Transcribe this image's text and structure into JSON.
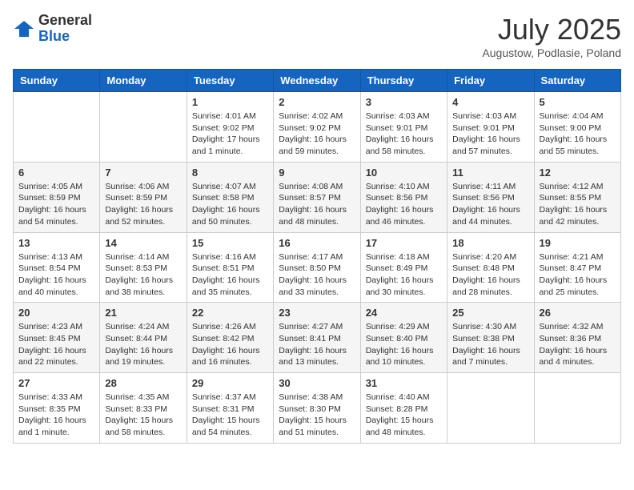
{
  "header": {
    "logo_general": "General",
    "logo_blue": "Blue",
    "month": "July 2025",
    "location": "Augustow, Podlasie, Poland"
  },
  "weekdays": [
    "Sunday",
    "Monday",
    "Tuesday",
    "Wednesday",
    "Thursday",
    "Friday",
    "Saturday"
  ],
  "weeks": [
    [
      {
        "day": "",
        "info": ""
      },
      {
        "day": "",
        "info": ""
      },
      {
        "day": "1",
        "info": "Sunrise: 4:01 AM\nSunset: 9:02 PM\nDaylight: 17 hours\nand 1 minute."
      },
      {
        "day": "2",
        "info": "Sunrise: 4:02 AM\nSunset: 9:02 PM\nDaylight: 16 hours\nand 59 minutes."
      },
      {
        "day": "3",
        "info": "Sunrise: 4:03 AM\nSunset: 9:01 PM\nDaylight: 16 hours\nand 58 minutes."
      },
      {
        "day": "4",
        "info": "Sunrise: 4:03 AM\nSunset: 9:01 PM\nDaylight: 16 hours\nand 57 minutes."
      },
      {
        "day": "5",
        "info": "Sunrise: 4:04 AM\nSunset: 9:00 PM\nDaylight: 16 hours\nand 55 minutes."
      }
    ],
    [
      {
        "day": "6",
        "info": "Sunrise: 4:05 AM\nSunset: 8:59 PM\nDaylight: 16 hours\nand 54 minutes."
      },
      {
        "day": "7",
        "info": "Sunrise: 4:06 AM\nSunset: 8:59 PM\nDaylight: 16 hours\nand 52 minutes."
      },
      {
        "day": "8",
        "info": "Sunrise: 4:07 AM\nSunset: 8:58 PM\nDaylight: 16 hours\nand 50 minutes."
      },
      {
        "day": "9",
        "info": "Sunrise: 4:08 AM\nSunset: 8:57 PM\nDaylight: 16 hours\nand 48 minutes."
      },
      {
        "day": "10",
        "info": "Sunrise: 4:10 AM\nSunset: 8:56 PM\nDaylight: 16 hours\nand 46 minutes."
      },
      {
        "day": "11",
        "info": "Sunrise: 4:11 AM\nSunset: 8:56 PM\nDaylight: 16 hours\nand 44 minutes."
      },
      {
        "day": "12",
        "info": "Sunrise: 4:12 AM\nSunset: 8:55 PM\nDaylight: 16 hours\nand 42 minutes."
      }
    ],
    [
      {
        "day": "13",
        "info": "Sunrise: 4:13 AM\nSunset: 8:54 PM\nDaylight: 16 hours\nand 40 minutes."
      },
      {
        "day": "14",
        "info": "Sunrise: 4:14 AM\nSunset: 8:53 PM\nDaylight: 16 hours\nand 38 minutes."
      },
      {
        "day": "15",
        "info": "Sunrise: 4:16 AM\nSunset: 8:51 PM\nDaylight: 16 hours\nand 35 minutes."
      },
      {
        "day": "16",
        "info": "Sunrise: 4:17 AM\nSunset: 8:50 PM\nDaylight: 16 hours\nand 33 minutes."
      },
      {
        "day": "17",
        "info": "Sunrise: 4:18 AM\nSunset: 8:49 PM\nDaylight: 16 hours\nand 30 minutes."
      },
      {
        "day": "18",
        "info": "Sunrise: 4:20 AM\nSunset: 8:48 PM\nDaylight: 16 hours\nand 28 minutes."
      },
      {
        "day": "19",
        "info": "Sunrise: 4:21 AM\nSunset: 8:47 PM\nDaylight: 16 hours\nand 25 minutes."
      }
    ],
    [
      {
        "day": "20",
        "info": "Sunrise: 4:23 AM\nSunset: 8:45 PM\nDaylight: 16 hours\nand 22 minutes."
      },
      {
        "day": "21",
        "info": "Sunrise: 4:24 AM\nSunset: 8:44 PM\nDaylight: 16 hours\nand 19 minutes."
      },
      {
        "day": "22",
        "info": "Sunrise: 4:26 AM\nSunset: 8:42 PM\nDaylight: 16 hours\nand 16 minutes."
      },
      {
        "day": "23",
        "info": "Sunrise: 4:27 AM\nSunset: 8:41 PM\nDaylight: 16 hours\nand 13 minutes."
      },
      {
        "day": "24",
        "info": "Sunrise: 4:29 AM\nSunset: 8:40 PM\nDaylight: 16 hours\nand 10 minutes."
      },
      {
        "day": "25",
        "info": "Sunrise: 4:30 AM\nSunset: 8:38 PM\nDaylight: 16 hours\nand 7 minutes."
      },
      {
        "day": "26",
        "info": "Sunrise: 4:32 AM\nSunset: 8:36 PM\nDaylight: 16 hours\nand 4 minutes."
      }
    ],
    [
      {
        "day": "27",
        "info": "Sunrise: 4:33 AM\nSunset: 8:35 PM\nDaylight: 16 hours\nand 1 minute."
      },
      {
        "day": "28",
        "info": "Sunrise: 4:35 AM\nSunset: 8:33 PM\nDaylight: 15 hours\nand 58 minutes."
      },
      {
        "day": "29",
        "info": "Sunrise: 4:37 AM\nSunset: 8:31 PM\nDaylight: 15 hours\nand 54 minutes."
      },
      {
        "day": "30",
        "info": "Sunrise: 4:38 AM\nSunset: 8:30 PM\nDaylight: 15 hours\nand 51 minutes."
      },
      {
        "day": "31",
        "info": "Sunrise: 4:40 AM\nSunset: 8:28 PM\nDaylight: 15 hours\nand 48 minutes."
      },
      {
        "day": "",
        "info": ""
      },
      {
        "day": "",
        "info": ""
      }
    ]
  ]
}
